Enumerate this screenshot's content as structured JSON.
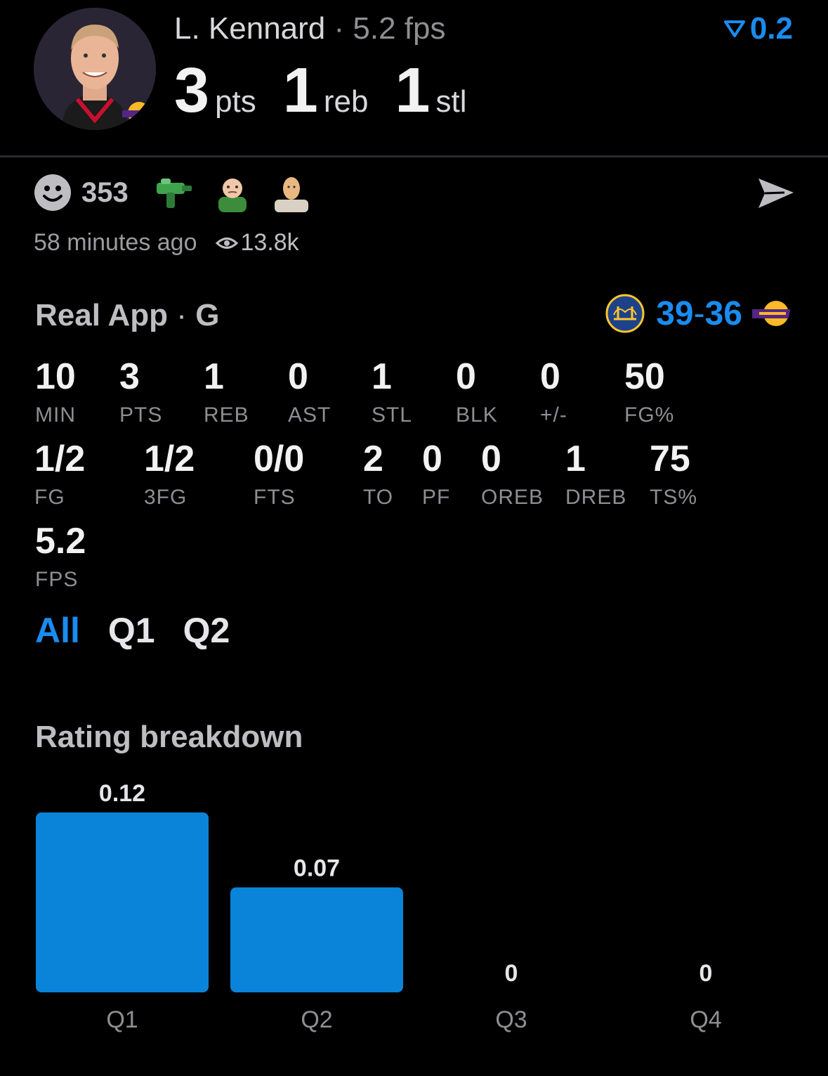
{
  "header": {
    "player_name": "L. Kennard",
    "separator": "·",
    "fps_text": "5.2 fps",
    "rating": "0.2",
    "rating_icon": "rating-chevron-icon",
    "headline": [
      {
        "value": "3",
        "unit": "pts"
      },
      {
        "value": "1",
        "unit": "reb"
      },
      {
        "value": "1",
        "unit": "stl"
      }
    ]
  },
  "social": {
    "reaction_count": "353",
    "emojis": [
      "water-gun-emoji",
      "success-kid-emoji",
      "bald-head-emoji"
    ],
    "time_ago": "58 minutes ago",
    "views": "13.8k"
  },
  "game": {
    "label": "Real App",
    "separator": "·",
    "position": "G",
    "home_score": "39",
    "away_score": "36",
    "score_sep": "-",
    "team_left": "warriors-logo",
    "team_right": "lakers-logo"
  },
  "stats": {
    "row1": [
      {
        "value": "10",
        "label": "MIN"
      },
      {
        "value": "3",
        "label": "PTS"
      },
      {
        "value": "1",
        "label": "REB"
      },
      {
        "value": "0",
        "label": "AST"
      },
      {
        "value": "1",
        "label": "STL"
      },
      {
        "value": "0",
        "label": "BLK"
      },
      {
        "value": "0",
        "label": "+/-"
      },
      {
        "value": "50",
        "label": "FG%"
      }
    ],
    "row2": [
      {
        "value": "1/2",
        "label": "FG"
      },
      {
        "value": "1/2",
        "label": "3FG"
      },
      {
        "value": "0/0",
        "label": "FTS"
      },
      {
        "value": "2",
        "label": "TO"
      },
      {
        "value": "0",
        "label": "PF"
      },
      {
        "value": "0",
        "label": "OREB"
      },
      {
        "value": "1",
        "label": "DREB"
      },
      {
        "value": "75",
        "label": "TS%"
      }
    ],
    "row3": [
      {
        "value": "5.2",
        "label": "FPS"
      }
    ]
  },
  "tabs": [
    {
      "label": "All",
      "active": true
    },
    {
      "label": "Q1",
      "active": false
    },
    {
      "label": "Q2",
      "active": false
    }
  ],
  "breakdown": {
    "title": "Rating breakdown"
  },
  "chart_data": {
    "type": "bar",
    "categories": [
      "Q1",
      "Q2",
      "Q3",
      "Q4"
    ],
    "values": [
      0.12,
      0.07,
      0,
      0
    ],
    "value_labels": [
      "0.12",
      "0.07",
      "0",
      "0"
    ],
    "color": "#0a84d8",
    "ylim": [
      0,
      0.12
    ],
    "grid": false,
    "legend": "none"
  },
  "colors": {
    "accent": "#1a8cf0",
    "bar": "#0a84d8",
    "background": "#000000"
  }
}
